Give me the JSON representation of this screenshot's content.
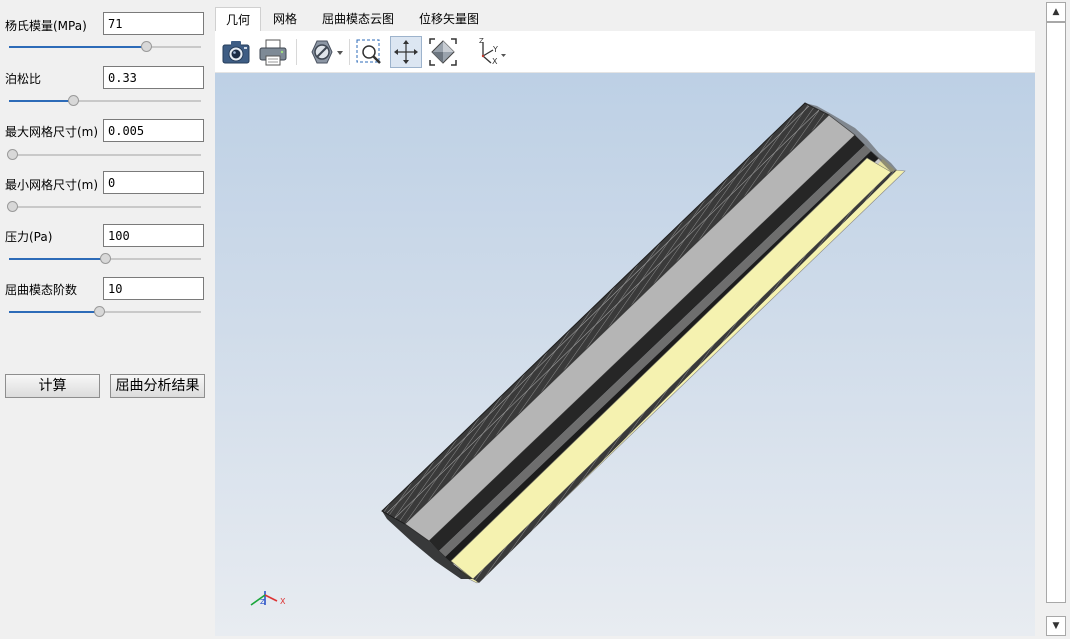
{
  "params": [
    {
      "label": "杨氏模量(MPa)",
      "value": "71",
      "slider_fraction": 0.72
    },
    {
      "label": "泊松比",
      "value": "0.33",
      "slider_fraction": 0.33
    },
    {
      "label": "最大网格尺寸(m)",
      "value": "0.005",
      "slider_fraction": 0.0
    },
    {
      "label": "最小网格尺寸(m)",
      "value": "0",
      "slider_fraction": 0.0
    },
    {
      "label": "压力(Pa)",
      "value": "100",
      "slider_fraction": 0.5
    },
    {
      "label": "屈曲模态阶数",
      "value": "10",
      "slider_fraction": 0.47
    }
  ],
  "buttons": {
    "compute": "计算",
    "buckling_results": "屈曲分析结果"
  },
  "tabs": [
    {
      "label": "几何",
      "active": true
    },
    {
      "label": "网格",
      "active": false
    },
    {
      "label": "屈曲模态云图",
      "active": false
    },
    {
      "label": "位移矢量图",
      "active": false
    }
  ],
  "toolbar": {
    "icons": [
      "camera-icon",
      "printer-icon",
      "no-entry-icon",
      "zoom-box-icon",
      "fit-view-icon",
      "view-orientation-icon",
      "axes-icon"
    ],
    "axis_label_y": "Y",
    "axis_label_x": "X",
    "axis_label_z": "Z"
  },
  "viewport": {
    "orientation_labels": {
      "z": "Z",
      "x": "X"
    },
    "colors": {
      "bg_top": "#bdd0e5",
      "bg_bottom": "#e8ecf1",
      "beam_gray": "#b5b5b5",
      "beam_yellow": "#f5f2b0",
      "beam_dark": "#2f2f2f"
    }
  }
}
